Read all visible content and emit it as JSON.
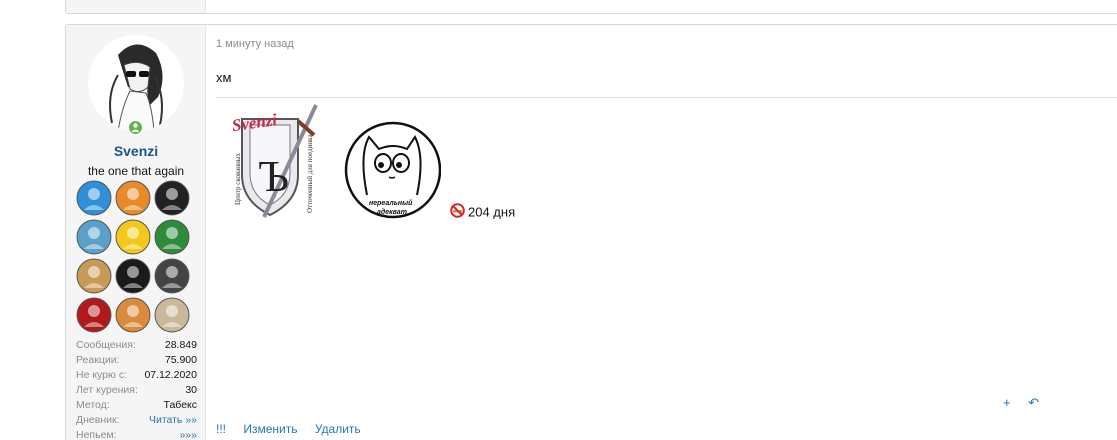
{
  "user": {
    "name": "Svenzi",
    "title": "the one that again"
  },
  "stats": [
    {
      "label": "Сообщения:",
      "value": "28.849",
      "link": false
    },
    {
      "label": "Реакции:",
      "value": "75.900",
      "link": false
    },
    {
      "label": "Не курю с:",
      "value": "07.12.2020",
      "link": false
    },
    {
      "label": "Лет курения:",
      "value": "30",
      "link": false
    },
    {
      "label": "Метод:",
      "value": "Табекс",
      "link": false
    },
    {
      "label": "Дневник:",
      "value": "Читать »»",
      "link": true
    },
    {
      "label": "Непьем:",
      "value": "»»»",
      "link": true
    }
  ],
  "awards": [
    {
      "icon": "blue-person-award-icon",
      "color": "#2f8fd8"
    },
    {
      "icon": "dog-award-icon",
      "color": "#e88a28"
    },
    {
      "icon": "spy-award-icon",
      "color": "#222222"
    },
    {
      "icon": "fish-award-icon",
      "color": "#5aa0c8"
    },
    {
      "icon": "flower-award-icon",
      "color": "#f2c81a"
    },
    {
      "icon": "power-award-icon",
      "color": "#2e8b3d"
    },
    {
      "icon": "stars-award-icon",
      "color": "#c79a55"
    },
    {
      "icon": "hat-award-icon",
      "color": "#1a1a1a"
    },
    {
      "icon": "detective-award-icon",
      "color": "#444444"
    },
    {
      "icon": "cards-award-icon",
      "color": "#b01a1a"
    },
    {
      "icon": "bear-award-icon",
      "color": "#d98a3a"
    },
    {
      "icon": "feather-award-icon",
      "color": "#c9b89a"
    }
  ],
  "post": {
    "time": "1 минуту назад",
    "message": "хм"
  },
  "signature": {
    "logo_text": "Svenzi",
    "logo_side_left": "Центр скованных",
    "logo_side_right": "Отточенный для поединка",
    "logo_letter": "Ъ",
    "cat_caption_1": "нереальный",
    "cat_caption_2": "адекват",
    "counter": "204 дня"
  },
  "actions": {
    "report": "!!!",
    "edit": "Изменить",
    "delete": "Удалить",
    "plus": "+",
    "reply": "↶"
  }
}
